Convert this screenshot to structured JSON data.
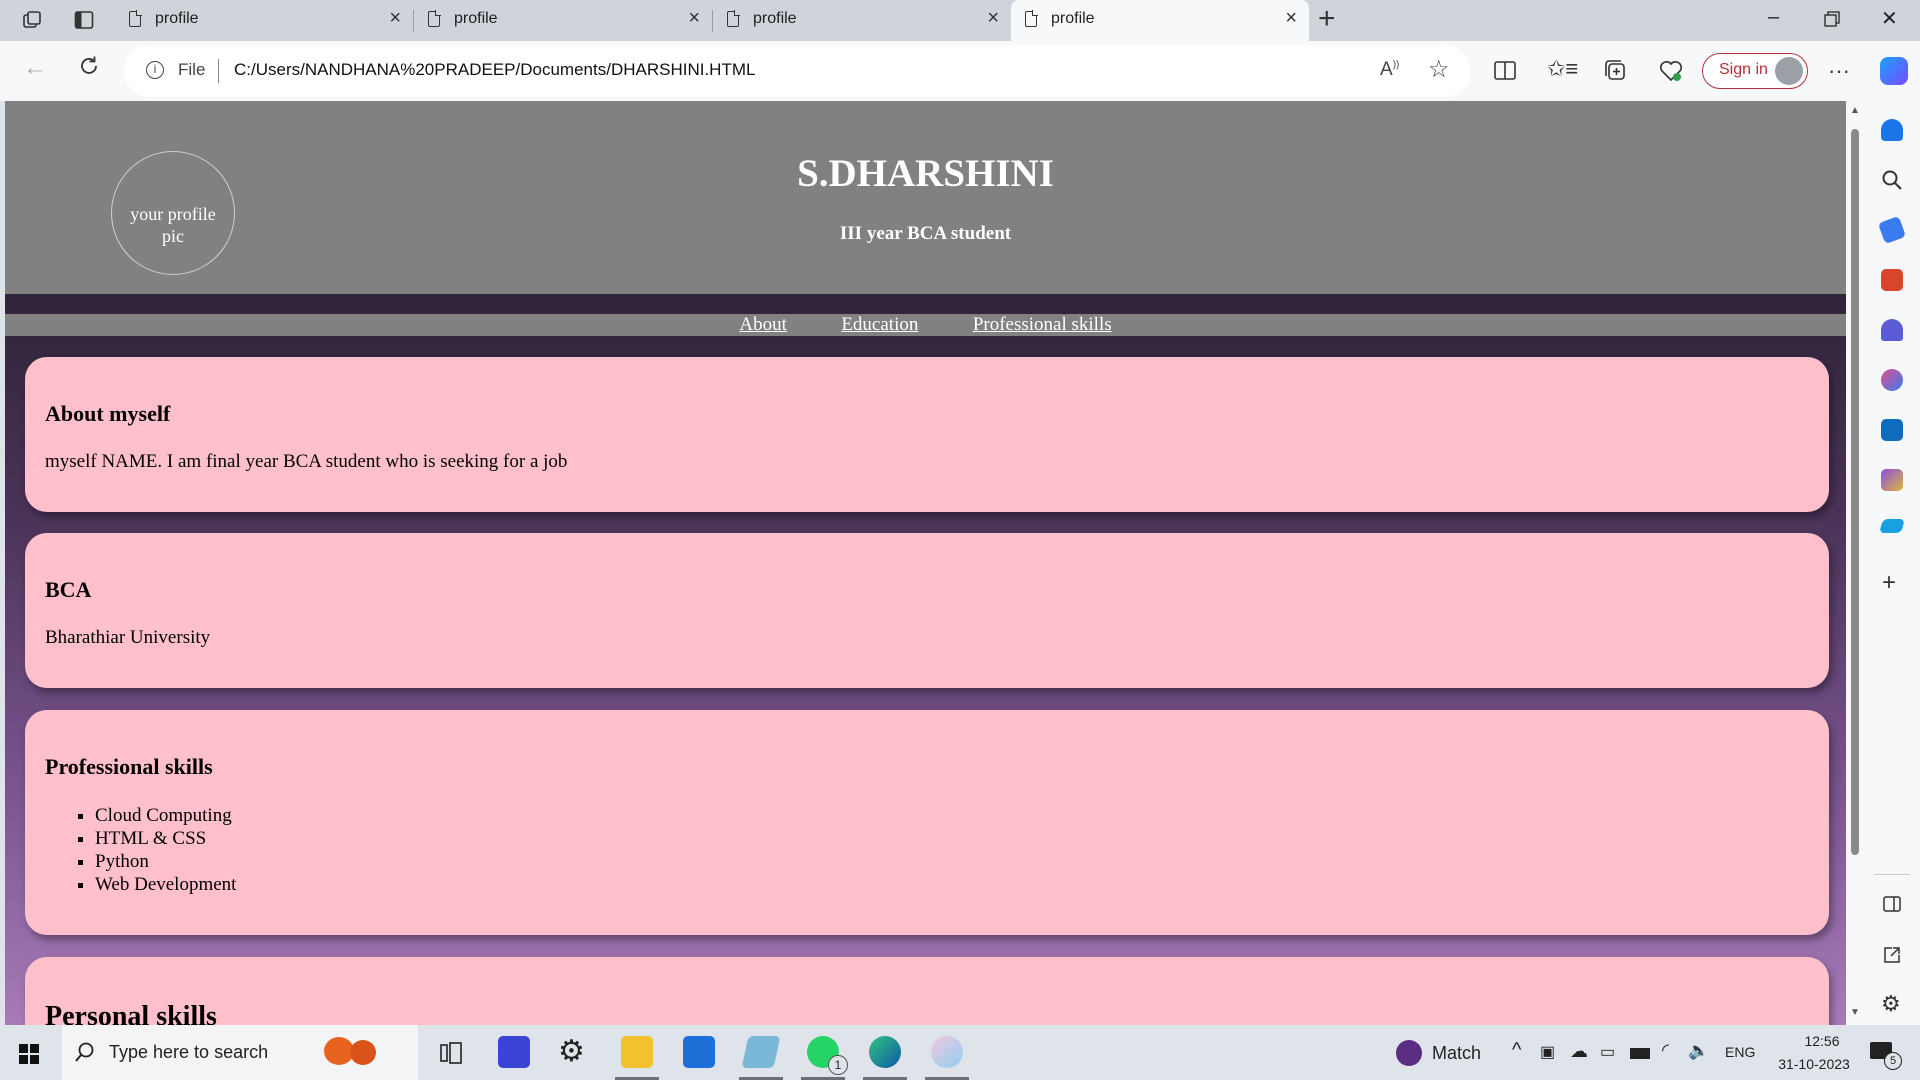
{
  "browser": {
    "tabs": [
      {
        "label": "profile",
        "active": false
      },
      {
        "label": "profile",
        "active": false
      },
      {
        "label": "profile",
        "active": false
      },
      {
        "label": "profile",
        "active": true
      }
    ],
    "new_tab_symbol": "+",
    "address": {
      "file_label": "File",
      "url": "C:/Users/NANDHANA%20PRADEEP/Documents/DHARSHINI.HTML"
    },
    "sign_in_label": "Sign in",
    "accent_color": "#b3323a"
  },
  "page": {
    "profile_pic_alt": "your profile pic",
    "name": "S.DHARSHINI",
    "subtitle": "III year BCA student",
    "nav": [
      "About",
      "Education",
      "Professional skills"
    ],
    "sections": {
      "about": {
        "heading": "About myself",
        "text": "myself NAME. I am final year BCA student who is seeking for a job"
      },
      "education": {
        "heading": "BCA",
        "text": "Bharathiar University"
      },
      "professional": {
        "heading": "Professional skills",
        "items": [
          "Cloud Computing",
          "HTML & CSS",
          "Python",
          "Web Development"
        ]
      },
      "personal": {
        "heading": "Personal skills"
      }
    },
    "colors": {
      "header_bg": "#818181",
      "card_bg": "#ffc0cb"
    }
  },
  "taskbar": {
    "search_placeholder": "Type here to search",
    "weather_label": "Match",
    "language": "ENG",
    "time": "12:56",
    "date": "31-10-2023",
    "whatsapp_badge": "1",
    "notification_count": "5"
  }
}
